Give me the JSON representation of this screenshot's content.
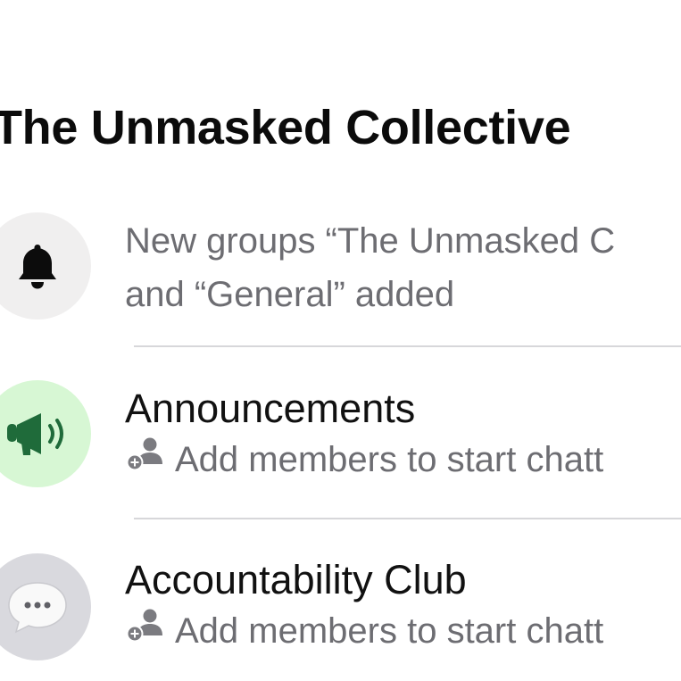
{
  "community": {
    "title": "The Unmasked Collective"
  },
  "notice": {
    "icon": "bell-icon",
    "line1": "New groups “The Unmasked C",
    "line2": "and “General” added"
  },
  "groups": [
    {
      "name": "Announcements",
      "icon": "megaphone-icon",
      "subtitle": "Add members to start chatt",
      "subtitle_icon": "add-member-icon",
      "avatar_bg": "#d7f7d4",
      "icon_color": "#1f6b3a"
    },
    {
      "name": "Accountability Club",
      "icon": "speech-bubble-icon",
      "subtitle": "Add members to start chatt",
      "subtitle_icon": "add-member-icon",
      "avatar_bg": "#d9d9de",
      "icon_color": "#f7f7f7"
    }
  ],
  "colors": {
    "title": "#0b0b0b",
    "secondary_text": "#6d6d72",
    "divider": "#d7d7da",
    "notice_avatar_bg": "#f0efef"
  }
}
